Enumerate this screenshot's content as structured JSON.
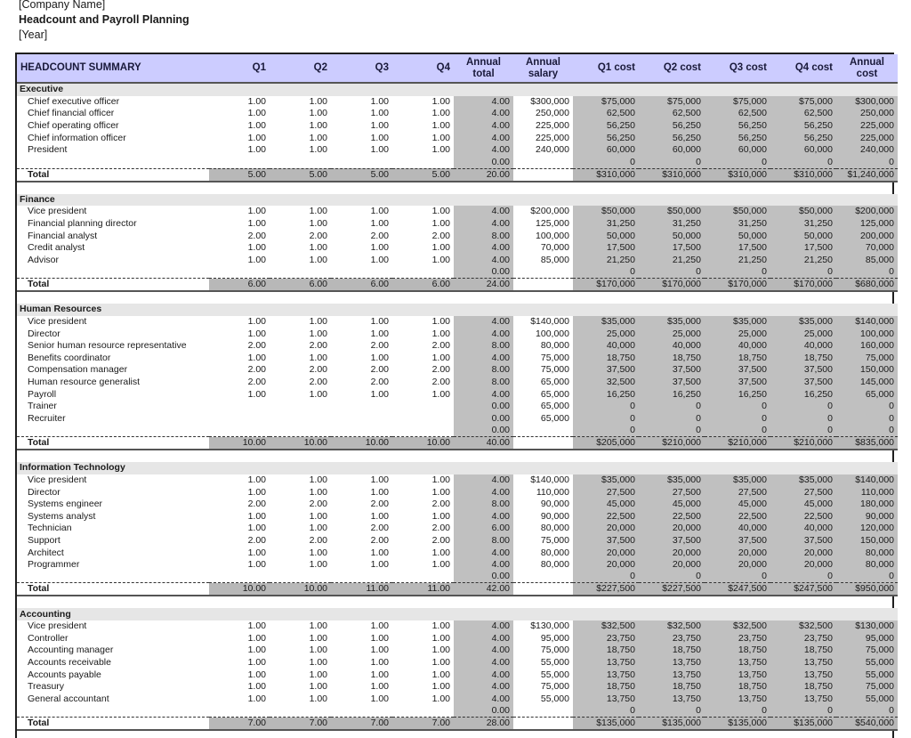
{
  "header": {
    "company": "[Company Name]",
    "title": "Headcount and Payroll Planning",
    "year": "[Year]"
  },
  "columns": {
    "summary": "HEADCOUNT SUMMARY",
    "q1": "Q1",
    "q2": "Q2",
    "q3": "Q3",
    "q4": "Q4",
    "annual_total_1": "Annual",
    "annual_total_2": "total",
    "annual_salary_1": "Annual",
    "annual_salary_2": "salary",
    "q1_cost": "Q1 cost",
    "q2_cost": "Q2 cost",
    "q3_cost": "Q3 cost",
    "q4_cost": "Q4 cost",
    "annual_cost_1": "Annual",
    "annual_cost_2": "cost"
  },
  "colors": {
    "header_bg": "#ccccff",
    "dept_bg": "#e6e6e6",
    "calc_bg": "#c0c0c0"
  },
  "total_label": "Total",
  "departments": [
    {
      "name": "Executive",
      "rows": [
        [
          "Chief executive officer",
          "1.00",
          "1.00",
          "1.00",
          "1.00",
          "4.00",
          "$300,000",
          "$75,000",
          "$75,000",
          "$75,000",
          "$75,000",
          "$300,000"
        ],
        [
          "Chief financial officer",
          "1.00",
          "1.00",
          "1.00",
          "1.00",
          "4.00",
          "250,000",
          "62,500",
          "62,500",
          "62,500",
          "62,500",
          "250,000"
        ],
        [
          "Chief operating officer",
          "1.00",
          "1.00",
          "1.00",
          "1.00",
          "4.00",
          "225,000",
          "56,250",
          "56,250",
          "56,250",
          "56,250",
          "225,000"
        ],
        [
          "Chief information officer",
          "1.00",
          "1.00",
          "1.00",
          "1.00",
          "4.00",
          "225,000",
          "56,250",
          "56,250",
          "56,250",
          "56,250",
          "225,000"
        ],
        [
          "President",
          "1.00",
          "1.00",
          "1.00",
          "1.00",
          "4.00",
          "240,000",
          "60,000",
          "60,000",
          "60,000",
          "60,000",
          "240,000"
        ]
      ],
      "zero_row": [
        "0.00",
        "0",
        "0",
        "0",
        "0",
        "0"
      ],
      "total": [
        "5.00",
        "5.00",
        "5.00",
        "5.00",
        "20.00",
        "",
        "$310,000",
        "$310,000",
        "$310,000",
        "$310,000",
        "$1,240,000"
      ]
    },
    {
      "name": "Finance",
      "rows": [
        [
          "Vice president",
          "1.00",
          "1.00",
          "1.00",
          "1.00",
          "4.00",
          "$200,000",
          "$50,000",
          "$50,000",
          "$50,000",
          "$50,000",
          "$200,000"
        ],
        [
          "Financial planning director",
          "1.00",
          "1.00",
          "1.00",
          "1.00",
          "4.00",
          "125,000",
          "31,250",
          "31,250",
          "31,250",
          "31,250",
          "125,000"
        ],
        [
          "Financial analyst",
          "2.00",
          "2.00",
          "2.00",
          "2.00",
          "8.00",
          "100,000",
          "50,000",
          "50,000",
          "50,000",
          "50,000",
          "200,000"
        ],
        [
          "Credit analyst",
          "1.00",
          "1.00",
          "1.00",
          "1.00",
          "4.00",
          "70,000",
          "17,500",
          "17,500",
          "17,500",
          "17,500",
          "70,000"
        ],
        [
          "Advisor",
          "1.00",
          "1.00",
          "1.00",
          "1.00",
          "4.00",
          "85,000",
          "21,250",
          "21,250",
          "21,250",
          "21,250",
          "85,000"
        ]
      ],
      "zero_row": [
        "0.00",
        "0",
        "0",
        "0",
        "0",
        "0"
      ],
      "total": [
        "6.00",
        "6.00",
        "6.00",
        "6.00",
        "24.00",
        "",
        "$170,000",
        "$170,000",
        "$170,000",
        "$170,000",
        "$680,000"
      ]
    },
    {
      "name": "Human Resources",
      "rows": [
        [
          "Vice president",
          "1.00",
          "1.00",
          "1.00",
          "1.00",
          "4.00",
          "$140,000",
          "$35,000",
          "$35,000",
          "$35,000",
          "$35,000",
          "$140,000"
        ],
        [
          "Director",
          "1.00",
          "1.00",
          "1.00",
          "1.00",
          "4.00",
          "100,000",
          "25,000",
          "25,000",
          "25,000",
          "25,000",
          "100,000"
        ],
        [
          "Senior human resource representative",
          "2.00",
          "2.00",
          "2.00",
          "2.00",
          "8.00",
          "80,000",
          "40,000",
          "40,000",
          "40,000",
          "40,000",
          "160,000"
        ],
        [
          "Benefits coordinator",
          "1.00",
          "1.00",
          "1.00",
          "1.00",
          "4.00",
          "75,000",
          "18,750",
          "18,750",
          "18,750",
          "18,750",
          "75,000"
        ],
        [
          "Compensation manager",
          "2.00",
          "2.00",
          "2.00",
          "2.00",
          "8.00",
          "75,000",
          "37,500",
          "37,500",
          "37,500",
          "37,500",
          "150,000"
        ],
        [
          "Human resource generalist",
          "2.00",
          "2.00",
          "2.00",
          "2.00",
          "8.00",
          "65,000",
          "32,500",
          "37,500",
          "37,500",
          "37,500",
          "145,000"
        ],
        [
          "Payroll",
          "1.00",
          "1.00",
          "1.00",
          "1.00",
          "4.00",
          "65,000",
          "16,250",
          "16,250",
          "16,250",
          "16,250",
          "65,000"
        ],
        [
          "Trainer",
          "",
          "",
          "",
          "",
          "0.00",
          "65,000",
          "0",
          "0",
          "0",
          "0",
          "0"
        ],
        [
          "Recruiter",
          "",
          "",
          "",
          "",
          "0.00",
          "65,000",
          "0",
          "0",
          "0",
          "0",
          "0"
        ]
      ],
      "zero_row": [
        "0.00",
        "0",
        "0",
        "0",
        "0",
        "0"
      ],
      "total": [
        "10.00",
        "10.00",
        "10.00",
        "10.00",
        "40.00",
        "",
        "$205,000",
        "$210,000",
        "$210,000",
        "$210,000",
        "$835,000"
      ]
    },
    {
      "name": "Information Technology",
      "rows": [
        [
          "Vice president",
          "1.00",
          "1.00",
          "1.00",
          "1.00",
          "4.00",
          "$140,000",
          "$35,000",
          "$35,000",
          "$35,000",
          "$35,000",
          "$140,000"
        ],
        [
          "Director",
          "1.00",
          "1.00",
          "1.00",
          "1.00",
          "4.00",
          "110,000",
          "27,500",
          "27,500",
          "27,500",
          "27,500",
          "110,000"
        ],
        [
          "Systems engineer",
          "2.00",
          "2.00",
          "2.00",
          "2.00",
          "8.00",
          "90,000",
          "45,000",
          "45,000",
          "45,000",
          "45,000",
          "180,000"
        ],
        [
          "Systems analyst",
          "1.00",
          "1.00",
          "1.00",
          "1.00",
          "4.00",
          "90,000",
          "22,500",
          "22,500",
          "22,500",
          "22,500",
          "90,000"
        ],
        [
          "Technician",
          "1.00",
          "1.00",
          "2.00",
          "2.00",
          "6.00",
          "80,000",
          "20,000",
          "20,000",
          "40,000",
          "40,000",
          "120,000"
        ],
        [
          "Support",
          "2.00",
          "2.00",
          "2.00",
          "2.00",
          "8.00",
          "75,000",
          "37,500",
          "37,500",
          "37,500",
          "37,500",
          "150,000"
        ],
        [
          "Architect",
          "1.00",
          "1.00",
          "1.00",
          "1.00",
          "4.00",
          "80,000",
          "20,000",
          "20,000",
          "20,000",
          "20,000",
          "80,000"
        ],
        [
          "Programmer",
          "1.00",
          "1.00",
          "1.00",
          "1.00",
          "4.00",
          "80,000",
          "20,000",
          "20,000",
          "20,000",
          "20,000",
          "80,000"
        ]
      ],
      "zero_row": [
        "0.00",
        "0",
        "0",
        "0",
        "0",
        "0"
      ],
      "total": [
        "10.00",
        "10.00",
        "11.00",
        "11.00",
        "42.00",
        "",
        "$227,500",
        "$227,500",
        "$247,500",
        "$247,500",
        "$950,000"
      ]
    },
    {
      "name": "Accounting",
      "rows": [
        [
          "Vice president",
          "1.00",
          "1.00",
          "1.00",
          "1.00",
          "4.00",
          "$130,000",
          "$32,500",
          "$32,500",
          "$32,500",
          "$32,500",
          "$130,000"
        ],
        [
          "Controller",
          "1.00",
          "1.00",
          "1.00",
          "1.00",
          "4.00",
          "95,000",
          "23,750",
          "23,750",
          "23,750",
          "23,750",
          "95,000"
        ],
        [
          "Accounting manager",
          "1.00",
          "1.00",
          "1.00",
          "1.00",
          "4.00",
          "75,000",
          "18,750",
          "18,750",
          "18,750",
          "18,750",
          "75,000"
        ],
        [
          "Accounts receivable",
          "1.00",
          "1.00",
          "1.00",
          "1.00",
          "4.00",
          "55,000",
          "13,750",
          "13,750",
          "13,750",
          "13,750",
          "55,000"
        ],
        [
          "Accounts payable",
          "1.00",
          "1.00",
          "1.00",
          "1.00",
          "4.00",
          "55,000",
          "13,750",
          "13,750",
          "13,750",
          "13,750",
          "55,000"
        ],
        [
          "Treasury",
          "1.00",
          "1.00",
          "1.00",
          "1.00",
          "4.00",
          "75,000",
          "18,750",
          "18,750",
          "18,750",
          "18,750",
          "75,000"
        ],
        [
          "General accountant",
          "1.00",
          "1.00",
          "1.00",
          "1.00",
          "4.00",
          "55,000",
          "13,750",
          "13,750",
          "13,750",
          "13,750",
          "55,000"
        ]
      ],
      "zero_row": [
        "0.00",
        "0",
        "0",
        "0",
        "0",
        "0"
      ],
      "total": [
        "7.00",
        "7.00",
        "7.00",
        "7.00",
        "28.00",
        "",
        "$135,000",
        "$135,000",
        "$135,000",
        "$135,000",
        "$540,000"
      ]
    }
  ]
}
